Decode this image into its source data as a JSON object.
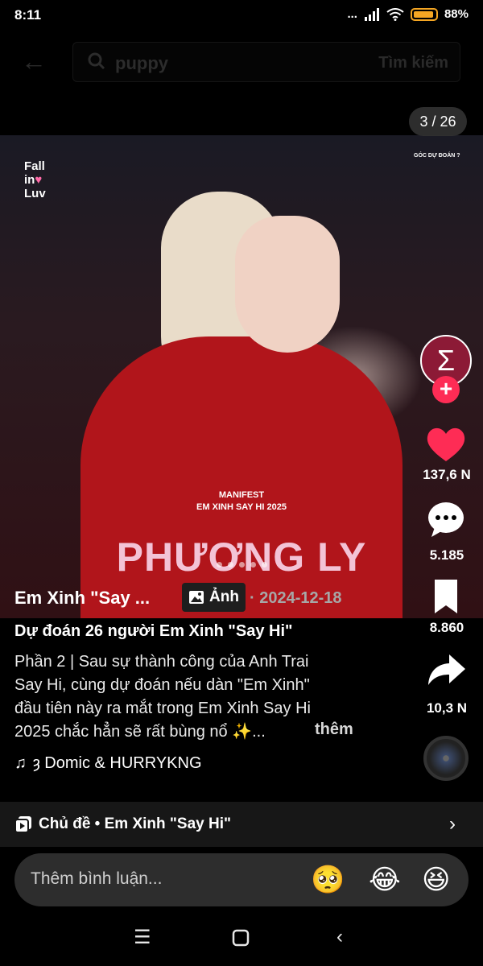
{
  "status_bar": {
    "time": "8:11",
    "signal_dots": "...",
    "battery_percent": "88%"
  },
  "search": {
    "query": "puppy",
    "button_label": "Tìm kiếm"
  },
  "post": {
    "slide_counter": "3 / 26",
    "image": {
      "brand_logo_lines": [
        "Fall",
        "in",
        "Luv"
      ],
      "corner_text": "GÓC DỰ ĐOÁN ?",
      "manifest_lines": [
        "MANIFEST",
        "EM XINH SAY HI 2025"
      ],
      "name": "PHƯƠNG LY"
    },
    "author": "Em Xinh \"Say ...",
    "badge_label": "Ảnh",
    "date": "· 2024-12-18",
    "title": "Dự đoán 26 người Em Xinh \"Say Hi\"",
    "description_lines": [
      "Phần 2 | Sau sự thành công của Anh Trai",
      "Say Hi, cùng dự đoán nếu dàn \"Em Xinh\"",
      "đầu tiên này ra mắt trong Em Xinh Say Hi",
      "2025 chắc hẳn sẽ rất bùng nổ ✨..."
    ],
    "more_label": "thêm",
    "music": "ȝ Domic & HURRYKNG"
  },
  "actions": {
    "likes": "137,6 N",
    "comments": "5.185",
    "saves": "8.860",
    "shares": "10,3 N"
  },
  "topic": {
    "label": "Chủ đề • Em Xinh \"Say Hi\""
  },
  "comment_bar": {
    "placeholder": "Thêm bình luận...",
    "emojis": [
      "🥺",
      "😂",
      "😆"
    ]
  },
  "colors": {
    "accent": "#fe2c55",
    "battery": "#f5a623",
    "background": "#000000"
  }
}
